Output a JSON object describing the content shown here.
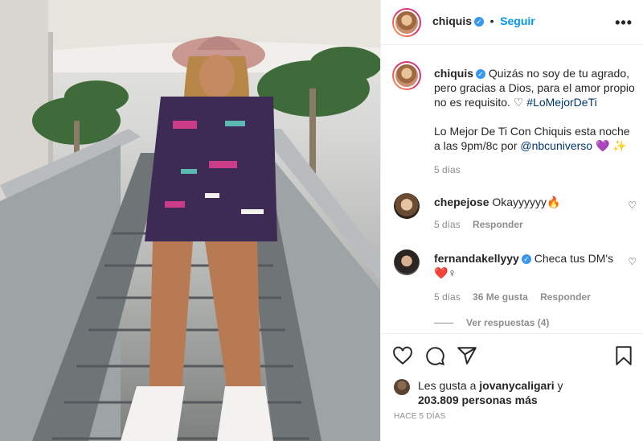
{
  "post": {
    "author": "chiquis",
    "follow_label": "Seguir",
    "more_icon": "more-options-icon"
  },
  "caption": {
    "author": "chiquis",
    "text_1": "Quizás no soy de tu agrado, pero gracias a Dios, para el amor propio no es requisito. ♡ ",
    "hashtag": "#LoMejorDeTi",
    "text_2": "Lo Mejor De Ti Con Chiquis esta noche a las 9pm/8c por ",
    "mention": "@nbcuniverso",
    "text_2_suffix": " 💜 ✨",
    "time": "5 días"
  },
  "comments": [
    {
      "user": "chepejose",
      "text": "Okayyyyyy🔥",
      "time": "5 días",
      "likes": "",
      "reply": "Responder"
    },
    {
      "user": "fernandakellyyy",
      "text": "Checa tus DM's",
      "text_2": "❤️♀",
      "time": "5 días",
      "likes": "36 Me gusta",
      "reply": "Responder"
    }
  ],
  "view_replies": "Ver respuestas (4)",
  "likes": {
    "prefix": "Les gusta a ",
    "user": "jovanycaligari",
    "suffix": " y",
    "count": "203.809 personas más"
  },
  "timestamp": "HACE 5 DÍAS",
  "colors": {
    "link": "#00376b",
    "follow": "#0095f6",
    "verified": "#3897f0",
    "muted": "#8e8e8e"
  }
}
